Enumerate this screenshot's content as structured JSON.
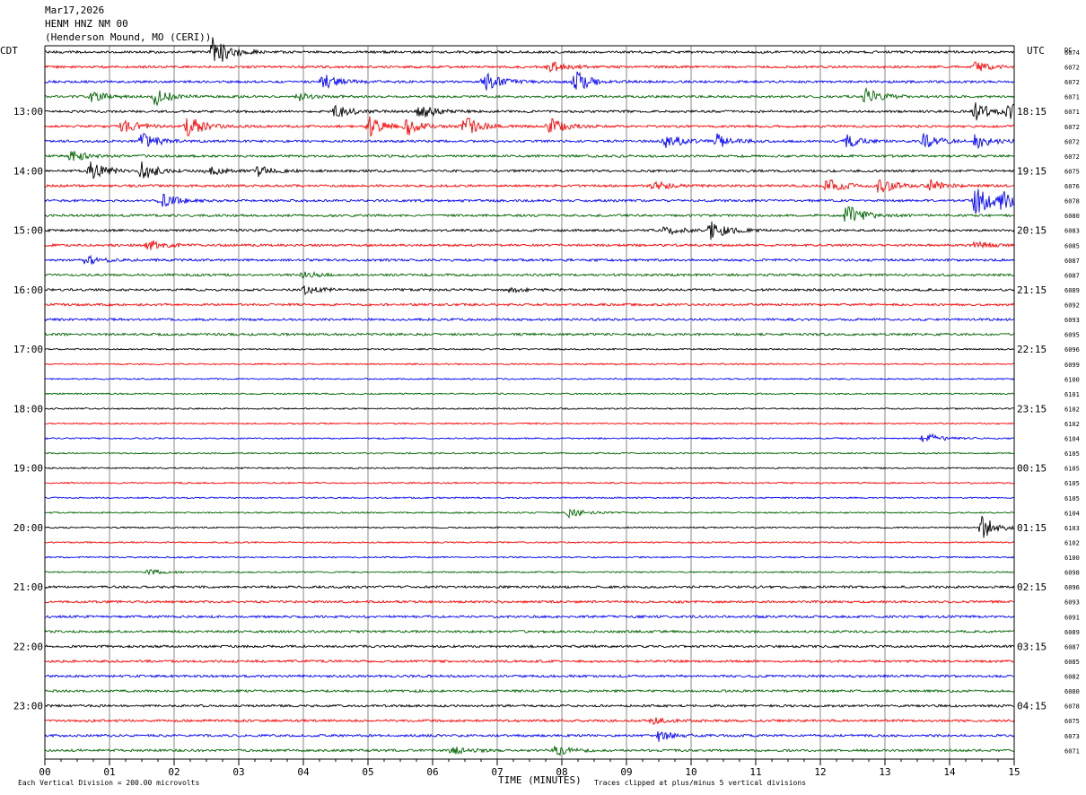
{
  "header": {
    "date": "Mar17,2026",
    "station": "HENM HNZ NM 00",
    "location": "(Henderson Mound, MO (CERI))"
  },
  "chart_data": {
    "type": "line",
    "title": "HENM HNZ NM 00",
    "xlabel": "TIME (MINUTES)",
    "xlim": [
      0,
      15
    ],
    "x_ticks": [
      "00",
      "01",
      "02",
      "03",
      "04",
      "05",
      "06",
      "07",
      "08",
      "09",
      "10",
      "11",
      "12",
      "13",
      "14",
      "15"
    ],
    "left_axis_label": "CDT",
    "right_axis_label": "UTC",
    "dc_label": "DC",
    "left_times": [
      "13:00",
      "14:00",
      "15:00",
      "16:00",
      "17:00",
      "18:00",
      "19:00",
      "20:00",
      "21:00",
      "22:00",
      "23:00"
    ],
    "right_times": [
      "18:15",
      "19:15",
      "20:15",
      "21:15",
      "22:15",
      "23:15",
      "00:15",
      "01:15",
      "02:15",
      "03:15",
      "04:15"
    ],
    "trace_colors": [
      "#000000",
      "#ff0000",
      "#0000ff",
      "#006400"
    ],
    "dc_offsets": [
      "6074",
      "6072",
      "6072",
      "6071",
      "6071",
      "6072",
      "6072",
      "6072",
      "6075",
      "6076",
      "6078",
      "6080",
      "6083",
      "6085",
      "6087",
      "6087",
      "6089",
      "6092",
      "6093",
      "6095",
      "6096",
      "6099",
      "6100",
      "6101",
      "6102",
      "6102",
      "6104",
      "6105",
      "6105",
      "6105",
      "6105",
      "6104",
      "6103",
      "6102",
      "6100",
      "6098",
      "6096",
      "6093",
      "6091",
      "6089",
      "6087",
      "6085",
      "6082",
      "6080",
      "6078",
      "6075",
      "6073",
      "6071"
    ],
    "events": [
      {
        "trace": 0,
        "minute": 2.6,
        "amp": 3.2
      },
      {
        "trace": 1,
        "minute": 7.8,
        "amp": 1.2
      },
      {
        "trace": 1,
        "minute": 14.4,
        "amp": 0.9
      },
      {
        "trace": 2,
        "minute": 4.3,
        "amp": 1.5
      },
      {
        "trace": 2,
        "minute": 6.8,
        "amp": 1.8
      },
      {
        "trace": 2,
        "minute": 8.2,
        "amp": 2.0
      },
      {
        "trace": 3,
        "minute": 0.7,
        "amp": 1.0
      },
      {
        "trace": 3,
        "minute": 1.7,
        "amp": 1.6
      },
      {
        "trace": 3,
        "minute": 3.9,
        "amp": 0.8
      },
      {
        "trace": 3,
        "minute": 12.7,
        "amp": 1.6
      },
      {
        "trace": 4,
        "minute": 4.5,
        "amp": 1.4
      },
      {
        "trace": 4,
        "minute": 5.8,
        "amp": 1.5
      },
      {
        "trace": 4,
        "minute": 14.4,
        "amp": 1.6
      },
      {
        "trace": 4,
        "minute": 14.9,
        "amp": 1.6
      },
      {
        "trace": 5,
        "minute": 1.2,
        "amp": 1.4
      },
      {
        "trace": 5,
        "minute": 2.2,
        "amp": 2.2
      },
      {
        "trace": 5,
        "minute": 5.0,
        "amp": 2.0
      },
      {
        "trace": 5,
        "minute": 5.6,
        "amp": 1.6
      },
      {
        "trace": 5,
        "minute": 6.5,
        "amp": 1.8
      },
      {
        "trace": 5,
        "minute": 7.8,
        "amp": 1.6
      },
      {
        "trace": 6,
        "minute": 1.5,
        "amp": 1.5
      },
      {
        "trace": 6,
        "minute": 9.6,
        "amp": 1.5
      },
      {
        "trace": 6,
        "minute": 10.4,
        "amp": 1.2
      },
      {
        "trace": 6,
        "minute": 12.4,
        "amp": 1.3
      },
      {
        "trace": 6,
        "minute": 13.6,
        "amp": 1.4
      },
      {
        "trace": 6,
        "minute": 14.4,
        "amp": 1.3
      },
      {
        "trace": 7,
        "minute": 0.4,
        "amp": 1.0
      },
      {
        "trace": 8,
        "minute": 0.7,
        "amp": 1.8
      },
      {
        "trace": 8,
        "minute": 1.5,
        "amp": 1.6
      },
      {
        "trace": 8,
        "minute": 2.5,
        "amp": 1.0
      },
      {
        "trace": 8,
        "minute": 3.3,
        "amp": 0.9
      },
      {
        "trace": 9,
        "minute": 9.4,
        "amp": 1.2
      },
      {
        "trace": 9,
        "minute": 12.1,
        "amp": 1.5
      },
      {
        "trace": 9,
        "minute": 12.9,
        "amp": 1.6
      },
      {
        "trace": 9,
        "minute": 13.7,
        "amp": 1.0
      },
      {
        "trace": 10,
        "minute": 1.8,
        "amp": 1.4
      },
      {
        "trace": 10,
        "minute": 14.4,
        "amp": 3.0
      },
      {
        "trace": 10,
        "minute": 14.8,
        "amp": 1.4
      },
      {
        "trace": 11,
        "minute": 12.4,
        "amp": 2.0
      },
      {
        "trace": 12,
        "minute": 9.6,
        "amp": 0.9
      },
      {
        "trace": 12,
        "minute": 10.3,
        "amp": 1.7
      },
      {
        "trace": 13,
        "minute": 1.6,
        "amp": 1.0
      },
      {
        "trace": 13,
        "minute": 14.4,
        "amp": 0.7
      },
      {
        "trace": 14,
        "minute": 0.6,
        "amp": 1.0
      },
      {
        "trace": 15,
        "minute": 4.0,
        "amp": 0.6
      },
      {
        "trace": 16,
        "minute": 4.0,
        "amp": 0.8
      },
      {
        "trace": 16,
        "minute": 7.2,
        "amp": 0.4
      },
      {
        "trace": 26,
        "minute": 13.6,
        "amp": 1.2
      },
      {
        "trace": 31,
        "minute": 8.1,
        "amp": 0.9
      },
      {
        "trace": 32,
        "minute": 14.5,
        "amp": 2.5
      },
      {
        "trace": 35,
        "minute": 1.6,
        "amp": 0.5
      },
      {
        "trace": 45,
        "minute": 9.4,
        "amp": 0.5
      },
      {
        "trace": 46,
        "minute": 9.5,
        "amp": 1.0
      },
      {
        "trace": 47,
        "minute": 6.3,
        "amp": 0.8
      },
      {
        "trace": 47,
        "minute": 7.9,
        "amp": 0.9
      }
    ]
  },
  "footer": {
    "scale_note": "Each Vertical Division =  200.00 microvolts",
    "clip_note": "Traces clipped at plus/minus 5 vertical divisions"
  }
}
